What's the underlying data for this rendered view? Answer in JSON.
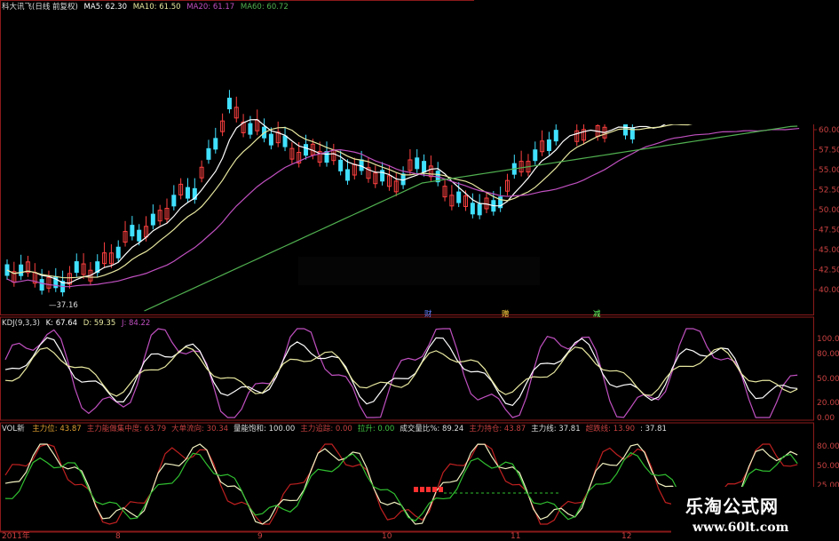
{
  "main_panel": {
    "title": "科大讯飞(日线 前复权)",
    "ma5": "MA5: 62.30",
    "ma10": "MA10: 61.50",
    "ma20": "MA20: 61.17",
    "ma60": "MA60: 60.72",
    "low_label": "37.16",
    "event_labels": [
      "财",
      "赠",
      "减"
    ],
    "price_axis": [
      "60.00",
      "57.50",
      "55.00",
      "52.50",
      "50.00",
      "47.50",
      "45.00",
      "42.50",
      "40.00"
    ]
  },
  "kdj_panel": {
    "title": "KDJ(9,3,3)",
    "k": "K: 67.64",
    "d": "D: 59.35",
    "j": "J: 84.22",
    "axis": [
      "100.00",
      "80.00",
      "50.00",
      "20.00",
      "0.00"
    ]
  },
  "vol_panel": {
    "title": "VOL新",
    "items": [
      {
        "text": "主力位: 43.87",
        "color": "#e0a030"
      },
      {
        "text": "主力能做集中度: 63.79",
        "color": "#c84040"
      },
      {
        "text": "大单流向: 30.34",
        "color": "#c84040"
      },
      {
        "text": "量能饱和: 100.00",
        "color": "#dddddd"
      },
      {
        "text": "主力追踪: 0.00",
        "color": "#c84040"
      },
      {
        "text": "拉升: 0.00",
        "color": "#40c040"
      },
      {
        "text": "成交量比%: 89.24",
        "color": "#dddddd"
      },
      {
        "text": "主力持仓: 43.87",
        "color": "#c84040"
      },
      {
        "text": "主力线: 37.81",
        "color": "#dddddd"
      },
      {
        "text": "超跌线: 13.90",
        "color": "#c84040"
      },
      {
        "text": ": 37.81",
        "color": "#dddddd"
      }
    ],
    "axis": [
      "80.00",
      "50.00",
      "25.00",
      "0.00"
    ]
  },
  "time_axis": [
    "2011年",
    "8",
    "9",
    "10",
    "11",
    "12"
  ],
  "watermark": {
    "title": "乐淘公式网",
    "url": "www.60lt.com"
  },
  "colors": {
    "up": "#ff4040",
    "down": "#40e0ff",
    "ma5": "#ffffff",
    "ma10": "#e8e8a0",
    "ma20": "#c050c0",
    "ma60": "#50b050",
    "border": "#8b1a1a"
  }
}
